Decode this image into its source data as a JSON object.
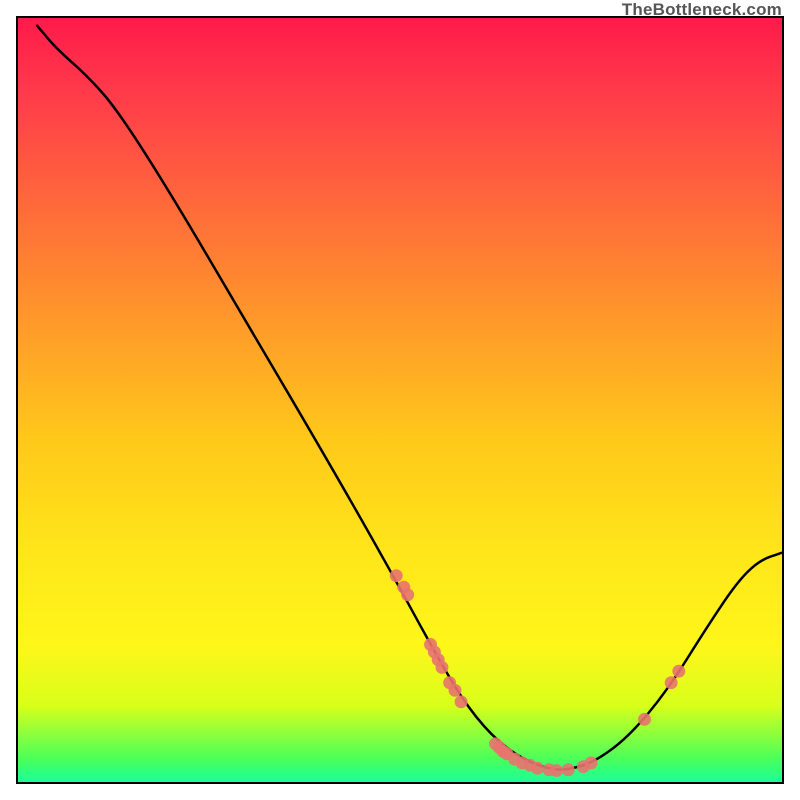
{
  "attribution": "TheBottleneck.com",
  "chart_data": {
    "type": "line",
    "title": "",
    "xlabel": "",
    "ylabel": "",
    "xlim": [
      0,
      100
    ],
    "ylim": [
      0,
      100
    ],
    "curve_points": [
      {
        "x": 2.5,
        "y": 99
      },
      {
        "x": 5,
        "y": 96
      },
      {
        "x": 9,
        "y": 92.5
      },
      {
        "x": 13,
        "y": 88
      },
      {
        "x": 20,
        "y": 77
      },
      {
        "x": 30,
        "y": 60
      },
      {
        "x": 40,
        "y": 43
      },
      {
        "x": 48,
        "y": 29
      },
      {
        "x": 54,
        "y": 18
      },
      {
        "x": 58,
        "y": 11
      },
      {
        "x": 62,
        "y": 6
      },
      {
        "x": 66,
        "y": 3
      },
      {
        "x": 70,
        "y": 1.5
      },
      {
        "x": 73,
        "y": 1.8
      },
      {
        "x": 76,
        "y": 3
      },
      {
        "x": 80,
        "y": 6
      },
      {
        "x": 85,
        "y": 12
      },
      {
        "x": 90,
        "y": 20
      },
      {
        "x": 94,
        "y": 26
      },
      {
        "x": 97,
        "y": 29
      },
      {
        "x": 100,
        "y": 30
      }
    ],
    "scatter_points": [
      {
        "x": 49.5,
        "y": 27
      },
      {
        "x": 50.5,
        "y": 25.5
      },
      {
        "x": 51,
        "y": 24.5
      },
      {
        "x": 54,
        "y": 18
      },
      {
        "x": 54.5,
        "y": 17
      },
      {
        "x": 55,
        "y": 16
      },
      {
        "x": 55.5,
        "y": 15
      },
      {
        "x": 56.5,
        "y": 13
      },
      {
        "x": 57.2,
        "y": 12
      },
      {
        "x": 58,
        "y": 10.5
      },
      {
        "x": 62.5,
        "y": 5
      },
      {
        "x": 63,
        "y": 4.5
      },
      {
        "x": 63.5,
        "y": 4
      },
      {
        "x": 64,
        "y": 3.7
      },
      {
        "x": 65,
        "y": 3
      },
      {
        "x": 66,
        "y": 2.5
      },
      {
        "x": 67,
        "y": 2.2
      },
      {
        "x": 68,
        "y": 1.8
      },
      {
        "x": 69.5,
        "y": 1.6
      },
      {
        "x": 70.5,
        "y": 1.5
      },
      {
        "x": 72,
        "y": 1.6
      },
      {
        "x": 74,
        "y": 2
      },
      {
        "x": 75,
        "y": 2.5
      },
      {
        "x": 82,
        "y": 8.2
      },
      {
        "x": 85.5,
        "y": 13
      },
      {
        "x": 86.5,
        "y": 14.5
      }
    ],
    "point_radius_px": 6.5
  }
}
